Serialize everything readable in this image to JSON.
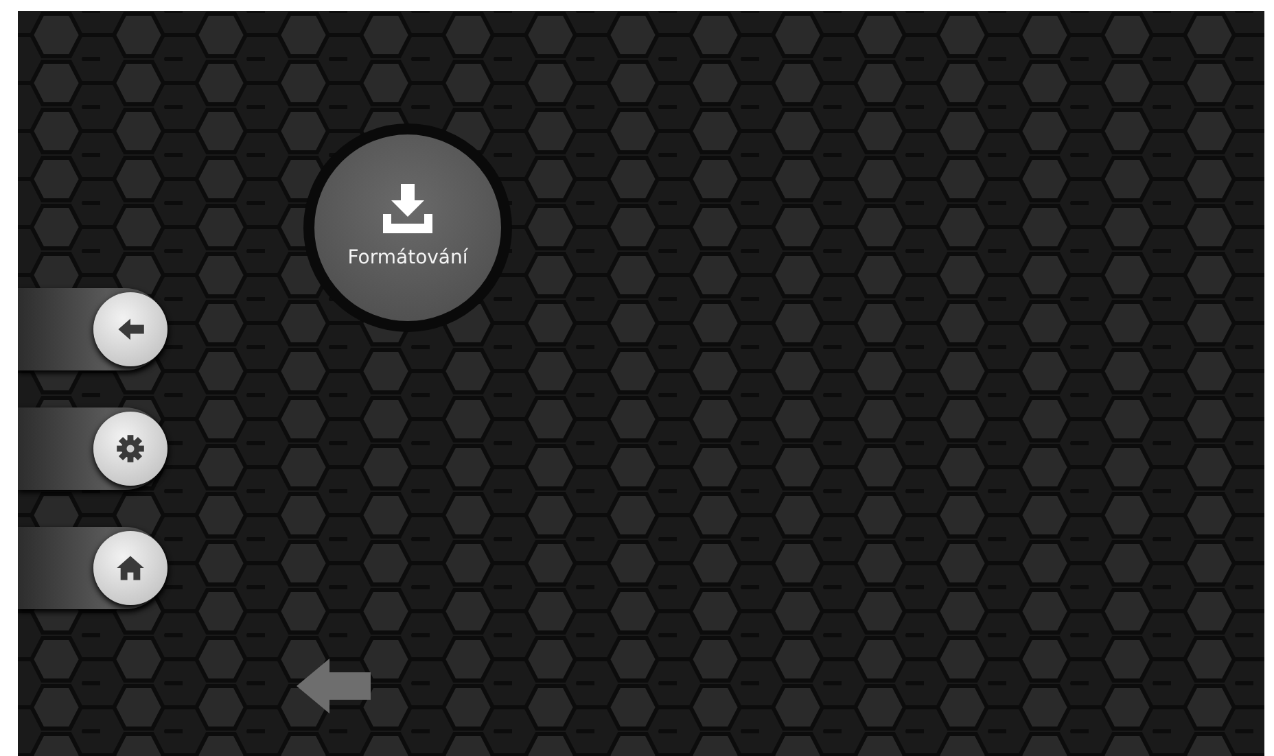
{
  "tile": {
    "label": "Formátování"
  },
  "side_buttons": [
    {
      "kind": "back"
    },
    {
      "kind": "settings"
    },
    {
      "kind": "home"
    }
  ]
}
